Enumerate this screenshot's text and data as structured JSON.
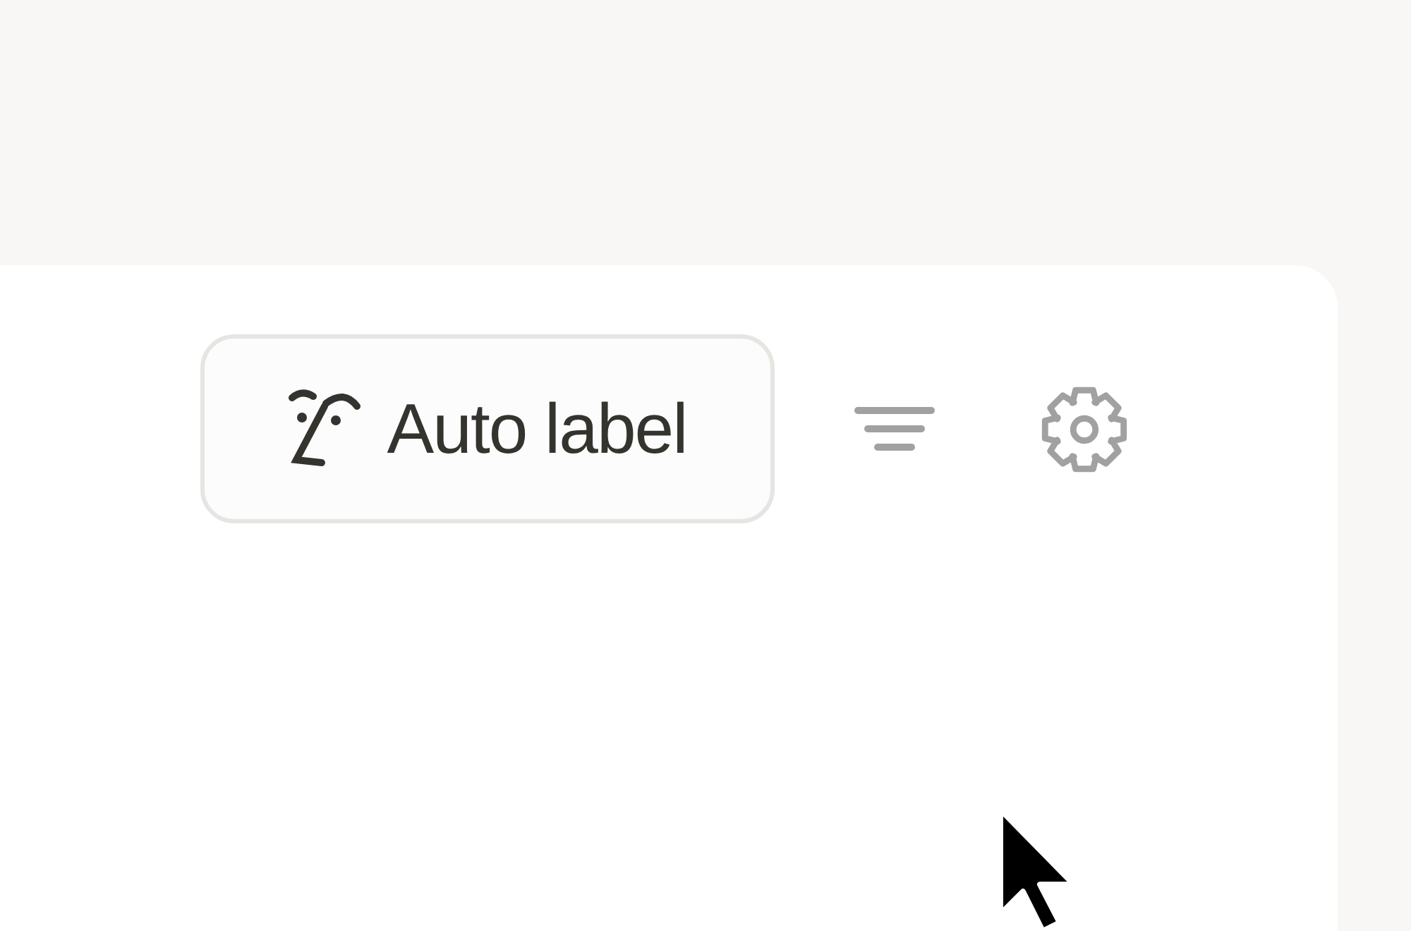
{
  "toolbar": {
    "buttons": [
      {
        "kind": "labeled",
        "label": "Auto label"
      },
      {
        "kind": "filter"
      },
      {
        "kind": "settings"
      }
    ]
  }
}
